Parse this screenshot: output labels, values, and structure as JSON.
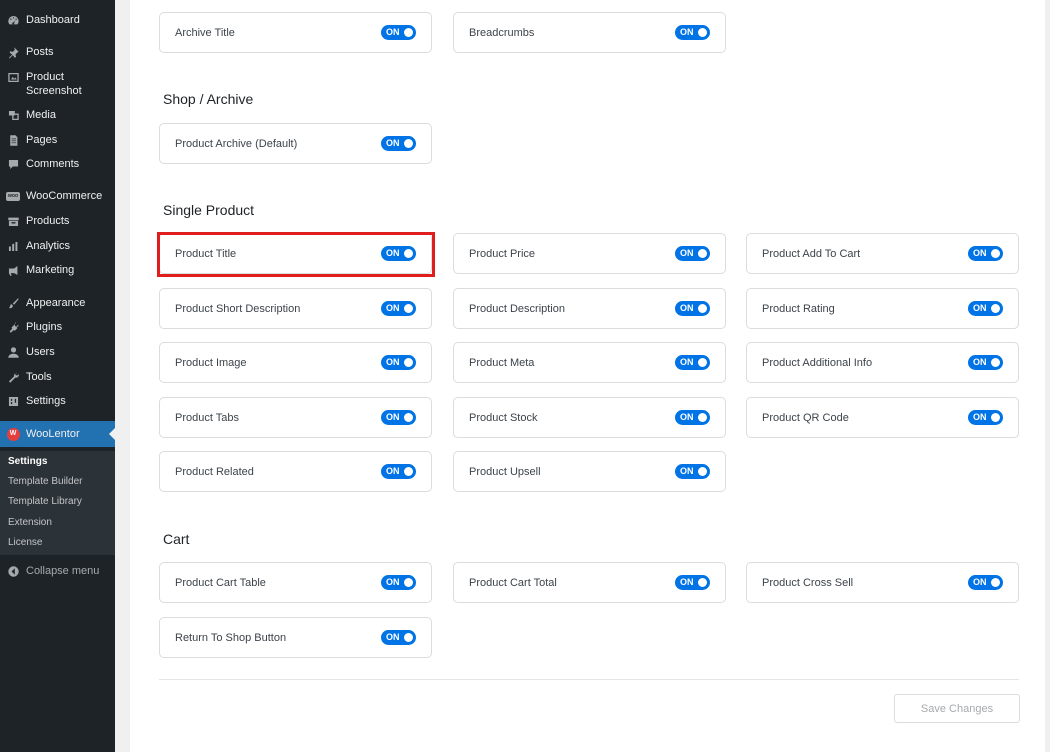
{
  "sidebar": {
    "items": [
      {
        "label": "Dashboard",
        "icon": "dashboard-icon"
      },
      {
        "label": "Posts",
        "icon": "pin-icon"
      },
      {
        "label": "Product Screenshot",
        "icon": "image-icon"
      },
      {
        "label": "Media",
        "icon": "media-icon"
      },
      {
        "label": "Pages",
        "icon": "page-icon"
      },
      {
        "label": "Comments",
        "icon": "comment-icon"
      },
      {
        "label": "WooCommerce",
        "icon": "woocommerce-icon"
      },
      {
        "label": "Products",
        "icon": "archive-icon"
      },
      {
        "label": "Analytics",
        "icon": "chart-icon"
      },
      {
        "label": "Marketing",
        "icon": "megaphone-icon"
      },
      {
        "label": "Appearance",
        "icon": "brush-icon"
      },
      {
        "label": "Plugins",
        "icon": "plug-icon"
      },
      {
        "label": "Users",
        "icon": "user-icon"
      },
      {
        "label": "Tools",
        "icon": "wrench-icon"
      },
      {
        "label": "Settings",
        "icon": "settings-icon"
      },
      {
        "label": "WooLentor",
        "icon": "woolentor-icon"
      }
    ],
    "submenu": [
      "Settings",
      "Template Builder",
      "Template Library",
      "Extension",
      "License"
    ],
    "collapse_label": "Collapse menu"
  },
  "top_row": [
    {
      "label": "Archive Title",
      "toggle": "ON"
    },
    {
      "label": "Breadcrumbs",
      "toggle": "ON"
    }
  ],
  "shop_archive": {
    "heading": "Shop / Archive",
    "items": [
      {
        "label": "Product Archive (Default)",
        "toggle": "ON"
      }
    ]
  },
  "single_product": {
    "heading": "Single Product",
    "items": [
      {
        "label": "Product Title",
        "toggle": "ON"
      },
      {
        "label": "Product Price",
        "toggle": "ON"
      },
      {
        "label": "Product Add To Cart",
        "toggle": "ON"
      },
      {
        "label": "Product Short Description",
        "toggle": "ON"
      },
      {
        "label": "Product Description",
        "toggle": "ON"
      },
      {
        "label": "Product Rating",
        "toggle": "ON"
      },
      {
        "label": "Product Image",
        "toggle": "ON"
      },
      {
        "label": "Product Meta",
        "toggle": "ON"
      },
      {
        "label": "Product Additional Info",
        "toggle": "ON"
      },
      {
        "label": "Product Tabs",
        "toggle": "ON"
      },
      {
        "label": "Product Stock",
        "toggle": "ON"
      },
      {
        "label": "Product QR Code",
        "toggle": "ON"
      },
      {
        "label": "Product Related",
        "toggle": "ON"
      },
      {
        "label": "Product Upsell",
        "toggle": "ON"
      }
    ]
  },
  "cart": {
    "heading": "Cart",
    "items": [
      {
        "label": "Product Cart Table",
        "toggle": "ON"
      },
      {
        "label": "Product Cart Total",
        "toggle": "ON"
      },
      {
        "label": "Product Cross Sell",
        "toggle": "ON"
      },
      {
        "label": "Return To Shop Button",
        "toggle": "ON"
      }
    ]
  },
  "save_label": "Save Changes",
  "colors": {
    "toggle_on": "#0073e6",
    "highlight": "#e01e1e",
    "sidebar_bg": "#1d2327",
    "active_menu": "#2271b1"
  }
}
